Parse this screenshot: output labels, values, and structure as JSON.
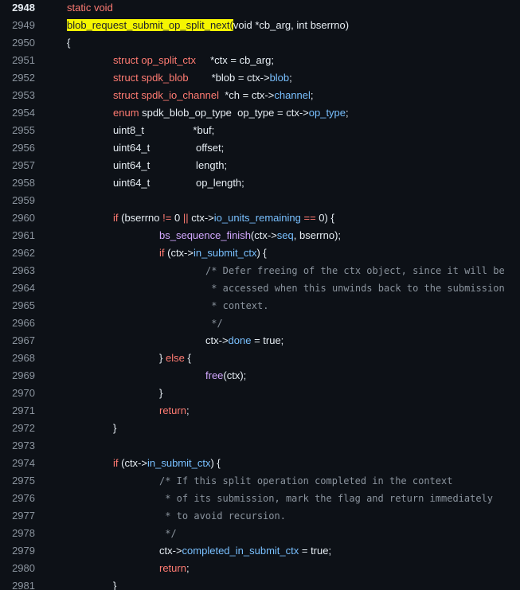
{
  "colors": {
    "background": "#0d1117",
    "text": "#e6edf3",
    "line_number": "#8b949e",
    "keyword": "#ff7b72",
    "comment": "#8b949e",
    "member": "#79c0ff",
    "function": "#d2a8ff",
    "highlight": "#f5f500"
  },
  "lines": [
    {
      "n": "2948",
      "current": true,
      "indent": 0,
      "tokens": [
        {
          "t": "static void",
          "k": "kw"
        }
      ]
    },
    {
      "n": "2949",
      "indent": 0,
      "tokens": [
        {
          "t": "blob_request_submit_op_split_next(",
          "k": "hl"
        },
        {
          "t": "void *cb_arg, int bserrno)",
          "k": ""
        }
      ]
    },
    {
      "n": "2950",
      "indent": 0,
      "tokens": [
        {
          "t": "{",
          "k": ""
        }
      ]
    },
    {
      "n": "2951",
      "indent": 1,
      "tokens": [
        {
          "t": "struct op_split_ctx",
          "k": "kw"
        },
        {
          "t": "     *ctx = cb_arg;",
          "k": ""
        }
      ]
    },
    {
      "n": "2952",
      "indent": 1,
      "tokens": [
        {
          "t": "struct spdk_blob",
          "k": "kw"
        },
        {
          "t": "        *blob = ctx->",
          "k": ""
        },
        {
          "t": "blob",
          "k": "mb"
        },
        {
          "t": ";",
          "k": ""
        }
      ]
    },
    {
      "n": "2953",
      "indent": 1,
      "tokens": [
        {
          "t": "struct spdk_io_channel",
          "k": "kw"
        },
        {
          "t": "  *ch = ctx->",
          "k": ""
        },
        {
          "t": "channel",
          "k": "mb"
        },
        {
          "t": ";",
          "k": ""
        }
      ]
    },
    {
      "n": "2954",
      "indent": 1,
      "tokens": [
        {
          "t": "enum",
          "k": "kw"
        },
        {
          "t": " spdk_blob_op_type  op_type = ctx->",
          "k": ""
        },
        {
          "t": "op_type",
          "k": "mb"
        },
        {
          "t": ";",
          "k": ""
        }
      ]
    },
    {
      "n": "2955",
      "indent": 1,
      "tokens": [
        {
          "t": "uint8_t                 *buf;",
          "k": ""
        }
      ]
    },
    {
      "n": "2956",
      "indent": 1,
      "tokens": [
        {
          "t": "uint64_t                offset;",
          "k": ""
        }
      ]
    },
    {
      "n": "2957",
      "indent": 1,
      "tokens": [
        {
          "t": "uint64_t                length;",
          "k": ""
        }
      ]
    },
    {
      "n": "2958",
      "indent": 1,
      "tokens": [
        {
          "t": "uint64_t                op_length;",
          "k": ""
        }
      ]
    },
    {
      "n": "2959",
      "indent": 0,
      "tokens": []
    },
    {
      "n": "2960",
      "indent": 1,
      "tokens": [
        {
          "t": "if",
          "k": "kw"
        },
        {
          "t": " (bserrno ",
          "k": ""
        },
        {
          "t": "!=",
          "k": "kw"
        },
        {
          "t": " 0 ",
          "k": ""
        },
        {
          "t": "||",
          "k": "kw"
        },
        {
          "t": " ctx->",
          "k": ""
        },
        {
          "t": "io_units_remaining",
          "k": "mb"
        },
        {
          "t": " ",
          "k": ""
        },
        {
          "t": "==",
          "k": "kw"
        },
        {
          "t": " 0) {",
          "k": ""
        }
      ]
    },
    {
      "n": "2961",
      "indent": 2,
      "tokens": [
        {
          "t": "bs_sequence_finish",
          "k": "fn"
        },
        {
          "t": "(ctx->",
          "k": ""
        },
        {
          "t": "seq",
          "k": "mb"
        },
        {
          "t": ", bserrno);",
          "k": ""
        }
      ]
    },
    {
      "n": "2962",
      "indent": 2,
      "tokens": [
        {
          "t": "if",
          "k": "kw"
        },
        {
          "t": " (ctx->",
          "k": ""
        },
        {
          "t": "in_submit_ctx",
          "k": "mb"
        },
        {
          "t": ") {",
          "k": ""
        }
      ]
    },
    {
      "n": "2963",
      "indent": 3,
      "tokens": [
        {
          "t": "/* Defer freeing of the ctx object, since it will be",
          "k": "cm"
        }
      ]
    },
    {
      "n": "2964",
      "indent": 3,
      "tokens": [
        {
          "t": " * accessed when this unwinds back to the submission",
          "k": "cm"
        }
      ]
    },
    {
      "n": "2965",
      "indent": 3,
      "tokens": [
        {
          "t": " * context.",
          "k": "cm"
        }
      ]
    },
    {
      "n": "2966",
      "indent": 3,
      "tokens": [
        {
          "t": " */",
          "k": "cm"
        }
      ]
    },
    {
      "n": "2967",
      "indent": 3,
      "tokens": [
        {
          "t": "ctx->",
          "k": ""
        },
        {
          "t": "done",
          "k": "mb"
        },
        {
          "t": " = true;",
          "k": ""
        }
      ]
    },
    {
      "n": "2968",
      "indent": 2,
      "tokens": [
        {
          "t": "} ",
          "k": ""
        },
        {
          "t": "else",
          "k": "kw"
        },
        {
          "t": " {",
          "k": ""
        }
      ]
    },
    {
      "n": "2969",
      "indent": 3,
      "tokens": [
        {
          "t": "free",
          "k": "fn"
        },
        {
          "t": "(ctx);",
          "k": ""
        }
      ]
    },
    {
      "n": "2970",
      "indent": 2,
      "tokens": [
        {
          "t": "}",
          "k": ""
        }
      ]
    },
    {
      "n": "2971",
      "indent": 2,
      "tokens": [
        {
          "t": "return",
          "k": "kw"
        },
        {
          "t": ";",
          "k": ""
        }
      ]
    },
    {
      "n": "2972",
      "indent": 1,
      "tokens": [
        {
          "t": "}",
          "k": ""
        }
      ]
    },
    {
      "n": "2973",
      "indent": 0,
      "tokens": []
    },
    {
      "n": "2974",
      "indent": 1,
      "tokens": [
        {
          "t": "if",
          "k": "kw"
        },
        {
          "t": " (ctx->",
          "k": ""
        },
        {
          "t": "in_submit_ctx",
          "k": "mb"
        },
        {
          "t": ") {",
          "k": ""
        }
      ]
    },
    {
      "n": "2975",
      "indent": 2,
      "tokens": [
        {
          "t": "/* If this split operation completed in the context",
          "k": "cm"
        }
      ]
    },
    {
      "n": "2976",
      "indent": 2,
      "tokens": [
        {
          "t": " * of its submission, mark the flag and return immediately",
          "k": "cm"
        }
      ]
    },
    {
      "n": "2977",
      "indent": 2,
      "tokens": [
        {
          "t": " * to avoid recursion.",
          "k": "cm"
        }
      ]
    },
    {
      "n": "2978",
      "indent": 2,
      "tokens": [
        {
          "t": " */",
          "k": "cm"
        }
      ]
    },
    {
      "n": "2979",
      "indent": 2,
      "tokens": [
        {
          "t": "ctx->",
          "k": ""
        },
        {
          "t": "completed_in_submit_ctx",
          "k": "mb"
        },
        {
          "t": " = true;",
          "k": ""
        }
      ]
    },
    {
      "n": "2980",
      "indent": 2,
      "tokens": [
        {
          "t": "return",
          "k": "kw"
        },
        {
          "t": ";",
          "k": ""
        }
      ]
    },
    {
      "n": "2981",
      "indent": 1,
      "tokens": [
        {
          "t": "}",
          "k": ""
        }
      ]
    }
  ]
}
